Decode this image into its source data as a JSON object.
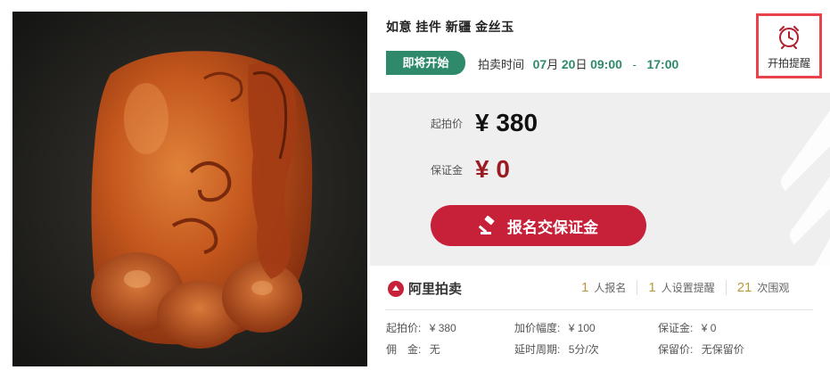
{
  "product": {
    "title": "如意 挂件 新疆 金丝玉"
  },
  "status": {
    "badge": "即将开始",
    "time_label": "拍卖时间",
    "month": "07",
    "month_unit": "月",
    "day": "20",
    "day_unit": "日",
    "start_time": "09:00",
    "separator": "-",
    "end_time": "17:00"
  },
  "remind": {
    "label": "开拍提醒"
  },
  "prices": {
    "start_label": "起拍价",
    "start_value": "¥ 380",
    "deposit_label": "保证金",
    "deposit_value": "¥ 0"
  },
  "actions": {
    "signup_label": "报名交保证金"
  },
  "brand": {
    "name": "阿里拍卖"
  },
  "stats": [
    {
      "num": "1",
      "label": "人报名"
    },
    {
      "num": "1",
      "label": "人设置提醒"
    },
    {
      "num": "21",
      "label": "次围观"
    }
  ],
  "info": {
    "start_price": {
      "k": "起拍价:",
      "v": "¥ 380"
    },
    "increment": {
      "k": "加价幅度:",
      "v": "¥ 100"
    },
    "deposit": {
      "k": "保证金:",
      "v": "¥ 0"
    },
    "commission": {
      "k": "佣　金:",
      "v": "无"
    },
    "delay": {
      "k": "延时周期:",
      "v": "5分/次"
    },
    "reserve": {
      "k": "保留价:",
      "v": "无保留价"
    }
  },
  "colors": {
    "status_green": "#2e8a6b",
    "remind_border": "#e8434b",
    "deposit_red": "#9b1b22",
    "button_red": "#c7213a",
    "stat_gold": "#b89a3e"
  }
}
